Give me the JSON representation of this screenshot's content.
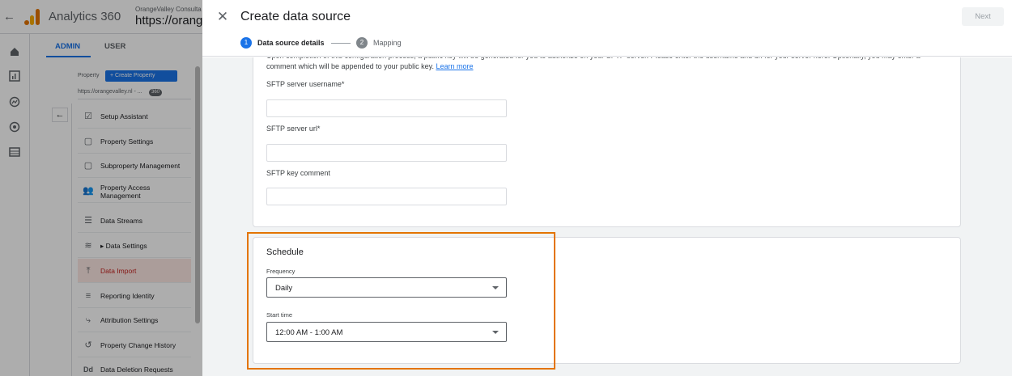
{
  "background": {
    "app_title": "Analytics 360",
    "account_name": "OrangeValley Consulta",
    "property_url_header": "https://orang",
    "tabs": [
      {
        "label": "ADMIN"
      },
      {
        "label": "USER"
      }
    ],
    "property_label": "Property",
    "create_property_label": "+ Create Property",
    "property_url": "https://orangevalley.nl - ...",
    "property_badge": "360",
    "nav_items": [
      {
        "label": "Setup Assistant",
        "icon": "checkbox-icon"
      },
      {
        "label": "Property Settings",
        "icon": "settings-square-icon"
      },
      {
        "label": "Subproperty Management",
        "icon": "subproperty-icon"
      },
      {
        "label": "Property Access Management",
        "icon": "people-icon"
      },
      {
        "label": "Data Streams",
        "icon": "streams-icon"
      },
      {
        "label": "▸ Data Settings",
        "icon": "database-icon"
      },
      {
        "label": "Data Import",
        "icon": "upload-icon"
      },
      {
        "label": "Reporting Identity",
        "icon": "identity-icon"
      },
      {
        "label": "Attribution Settings",
        "icon": "attribution-icon"
      },
      {
        "label": "Property Change History",
        "icon": "history-icon"
      },
      {
        "label": "Data Deletion Requests",
        "icon": "deletion-icon"
      }
    ]
  },
  "dialog": {
    "title": "Create data source",
    "next_label": "Next",
    "steps": [
      {
        "number": "1",
        "label": "Data source details"
      },
      {
        "number": "2",
        "label": "Mapping"
      }
    ],
    "description": "Upon completion of this configuration process, a public key will be generated for you to authorize on your SFTP server. Please enter the username and url for your server here. Optionally, you may enter a comment which will be appended to your public key.",
    "learn_more": "Learn more",
    "fields": {
      "username_label": "SFTP server username*",
      "username_value": "",
      "url_label": "SFTP server url*",
      "url_value": "",
      "comment_label": "SFTP key comment",
      "comment_value": ""
    },
    "schedule": {
      "title": "Schedule",
      "frequency_label": "Frequency",
      "frequency_value": "Daily",
      "start_time_label": "Start time",
      "start_time_value": "12:00 AM - 1:00 AM"
    }
  },
  "colors": {
    "accent": "#1a73e8",
    "highlight": "#e37400",
    "active_nav": "#c5221f"
  }
}
